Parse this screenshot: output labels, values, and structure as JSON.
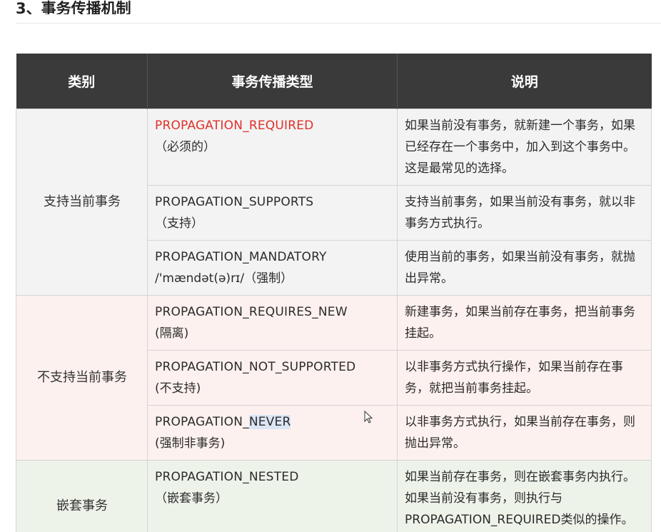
{
  "section_heading": "3、事务传播机制",
  "headers": {
    "category": "类别",
    "type": "事务传播类型",
    "description": "说明"
  },
  "groups": {
    "support": "支持当前事务",
    "nosupport": "不支持当前事务",
    "nested": "嵌套事务"
  },
  "rows": [
    {
      "name": "PROPAGATION_REQUIRED",
      "sub": "（必须的）",
      "desc": "如果当前没有事务，就新建一个事务，如果已经存在一个事务中，加入到这个事务中。这是最常见的选择。",
      "name_color": "#e0312a"
    },
    {
      "name": "PROPAGATION_SUPPORTS",
      "sub": "（支持）",
      "desc": "支持当前事务，如果当前没有事务，就以非事务方式执行。"
    },
    {
      "name": "PROPAGATION_MANDATORY",
      "sub": "/'mændət(ə)rɪ/（强制）",
      "desc": "使用当前的事务，如果当前没有事务，就抛出异常。"
    },
    {
      "name": "PROPAGATION_REQUIRES_NEW",
      "sub": "(隔离)",
      "desc": "新建事务，如果当前存在事务，把当前事务挂起。"
    },
    {
      "name": "PROPAGATION_NOT_SUPPORTED",
      "sub": "(不支持)",
      "desc": "以非事务方式执行操作，如果当前存在事务，就把当前事务挂起。"
    },
    {
      "name_prefix": "PROPAGATION_",
      "name_highlight": "NEVER",
      "sub": "(强制非事务)",
      "desc": "以非事务方式执行，如果当前存在事务，则抛出异常。"
    },
    {
      "name": "PROPAGATION_NESTED",
      "sub": "（嵌套事务）",
      "desc": "如果当前存在事务，则在嵌套事务内执行。如果当前没有事务，则执行与PROPAGATION_REQUIRED类似的操作。"
    }
  ]
}
